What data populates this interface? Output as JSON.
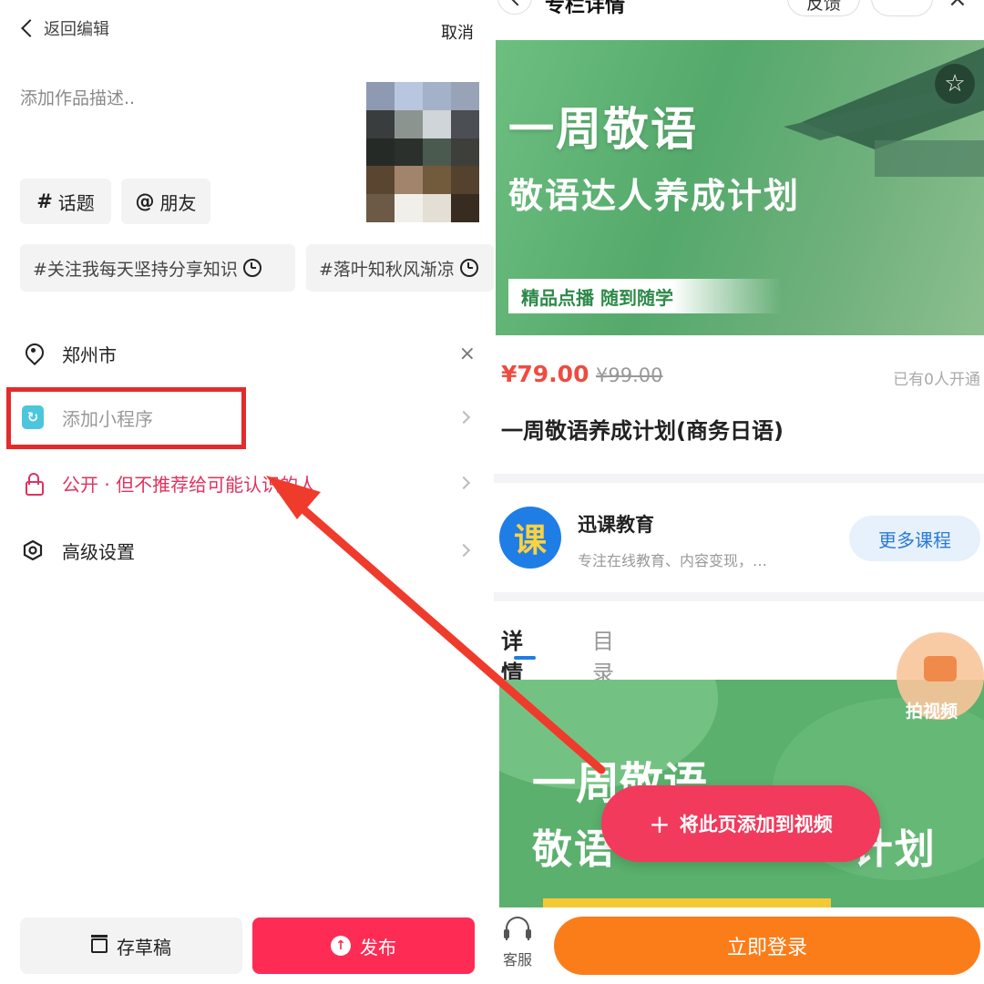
{
  "left": {
    "back_label": "返回编辑",
    "cancel_label": "取消",
    "description_placeholder": "添加作品描述..",
    "topic_label": "话题",
    "topic_symbol": "#",
    "friend_label": "朋友",
    "friend_symbol": "@",
    "suggested_tags": [
      "#关注我每天坚持分享知识",
      "#落叶知秋风渐凉"
    ],
    "location": "郑州市",
    "mini_program_label": "添加小程序",
    "privacy_label": "公开 · 但不推荐给可能认识的人",
    "advanced_label": "高级设置",
    "draft_label": "存草稿",
    "publish_label": "发布"
  },
  "right": {
    "page_title": "专栏详情",
    "feedback_label": "反馈",
    "banner": {
      "title": "一周敬语",
      "subtitle": "敬语达人养成计划",
      "tagline": "精品点播  随到随学"
    },
    "price": "¥79.00",
    "original_price": "¥99.00",
    "enrolled_text": "已有0人开通",
    "course_title": "一周敬语养成计划(商务日语)",
    "org": {
      "logo_char": "课",
      "name": "迅课教育",
      "description": "专注在线教育、内容变现，…",
      "more_label": "更多课程"
    },
    "tabs": [
      "详情",
      "目录"
    ],
    "detail_banner": {
      "line1": "一周敬语",
      "line2": "敬语               计划"
    },
    "shoot_video_label": "拍视频",
    "add_to_video_label": "将此页添加到视频",
    "service_label": "客服",
    "login_label": "立即登录"
  },
  "colors": {
    "highlight_box": "#e42b2b",
    "arrow": "#ef3b2c",
    "publish": "#fe2c55",
    "login": "#fb7d1a",
    "price": "#ef4b3f"
  }
}
